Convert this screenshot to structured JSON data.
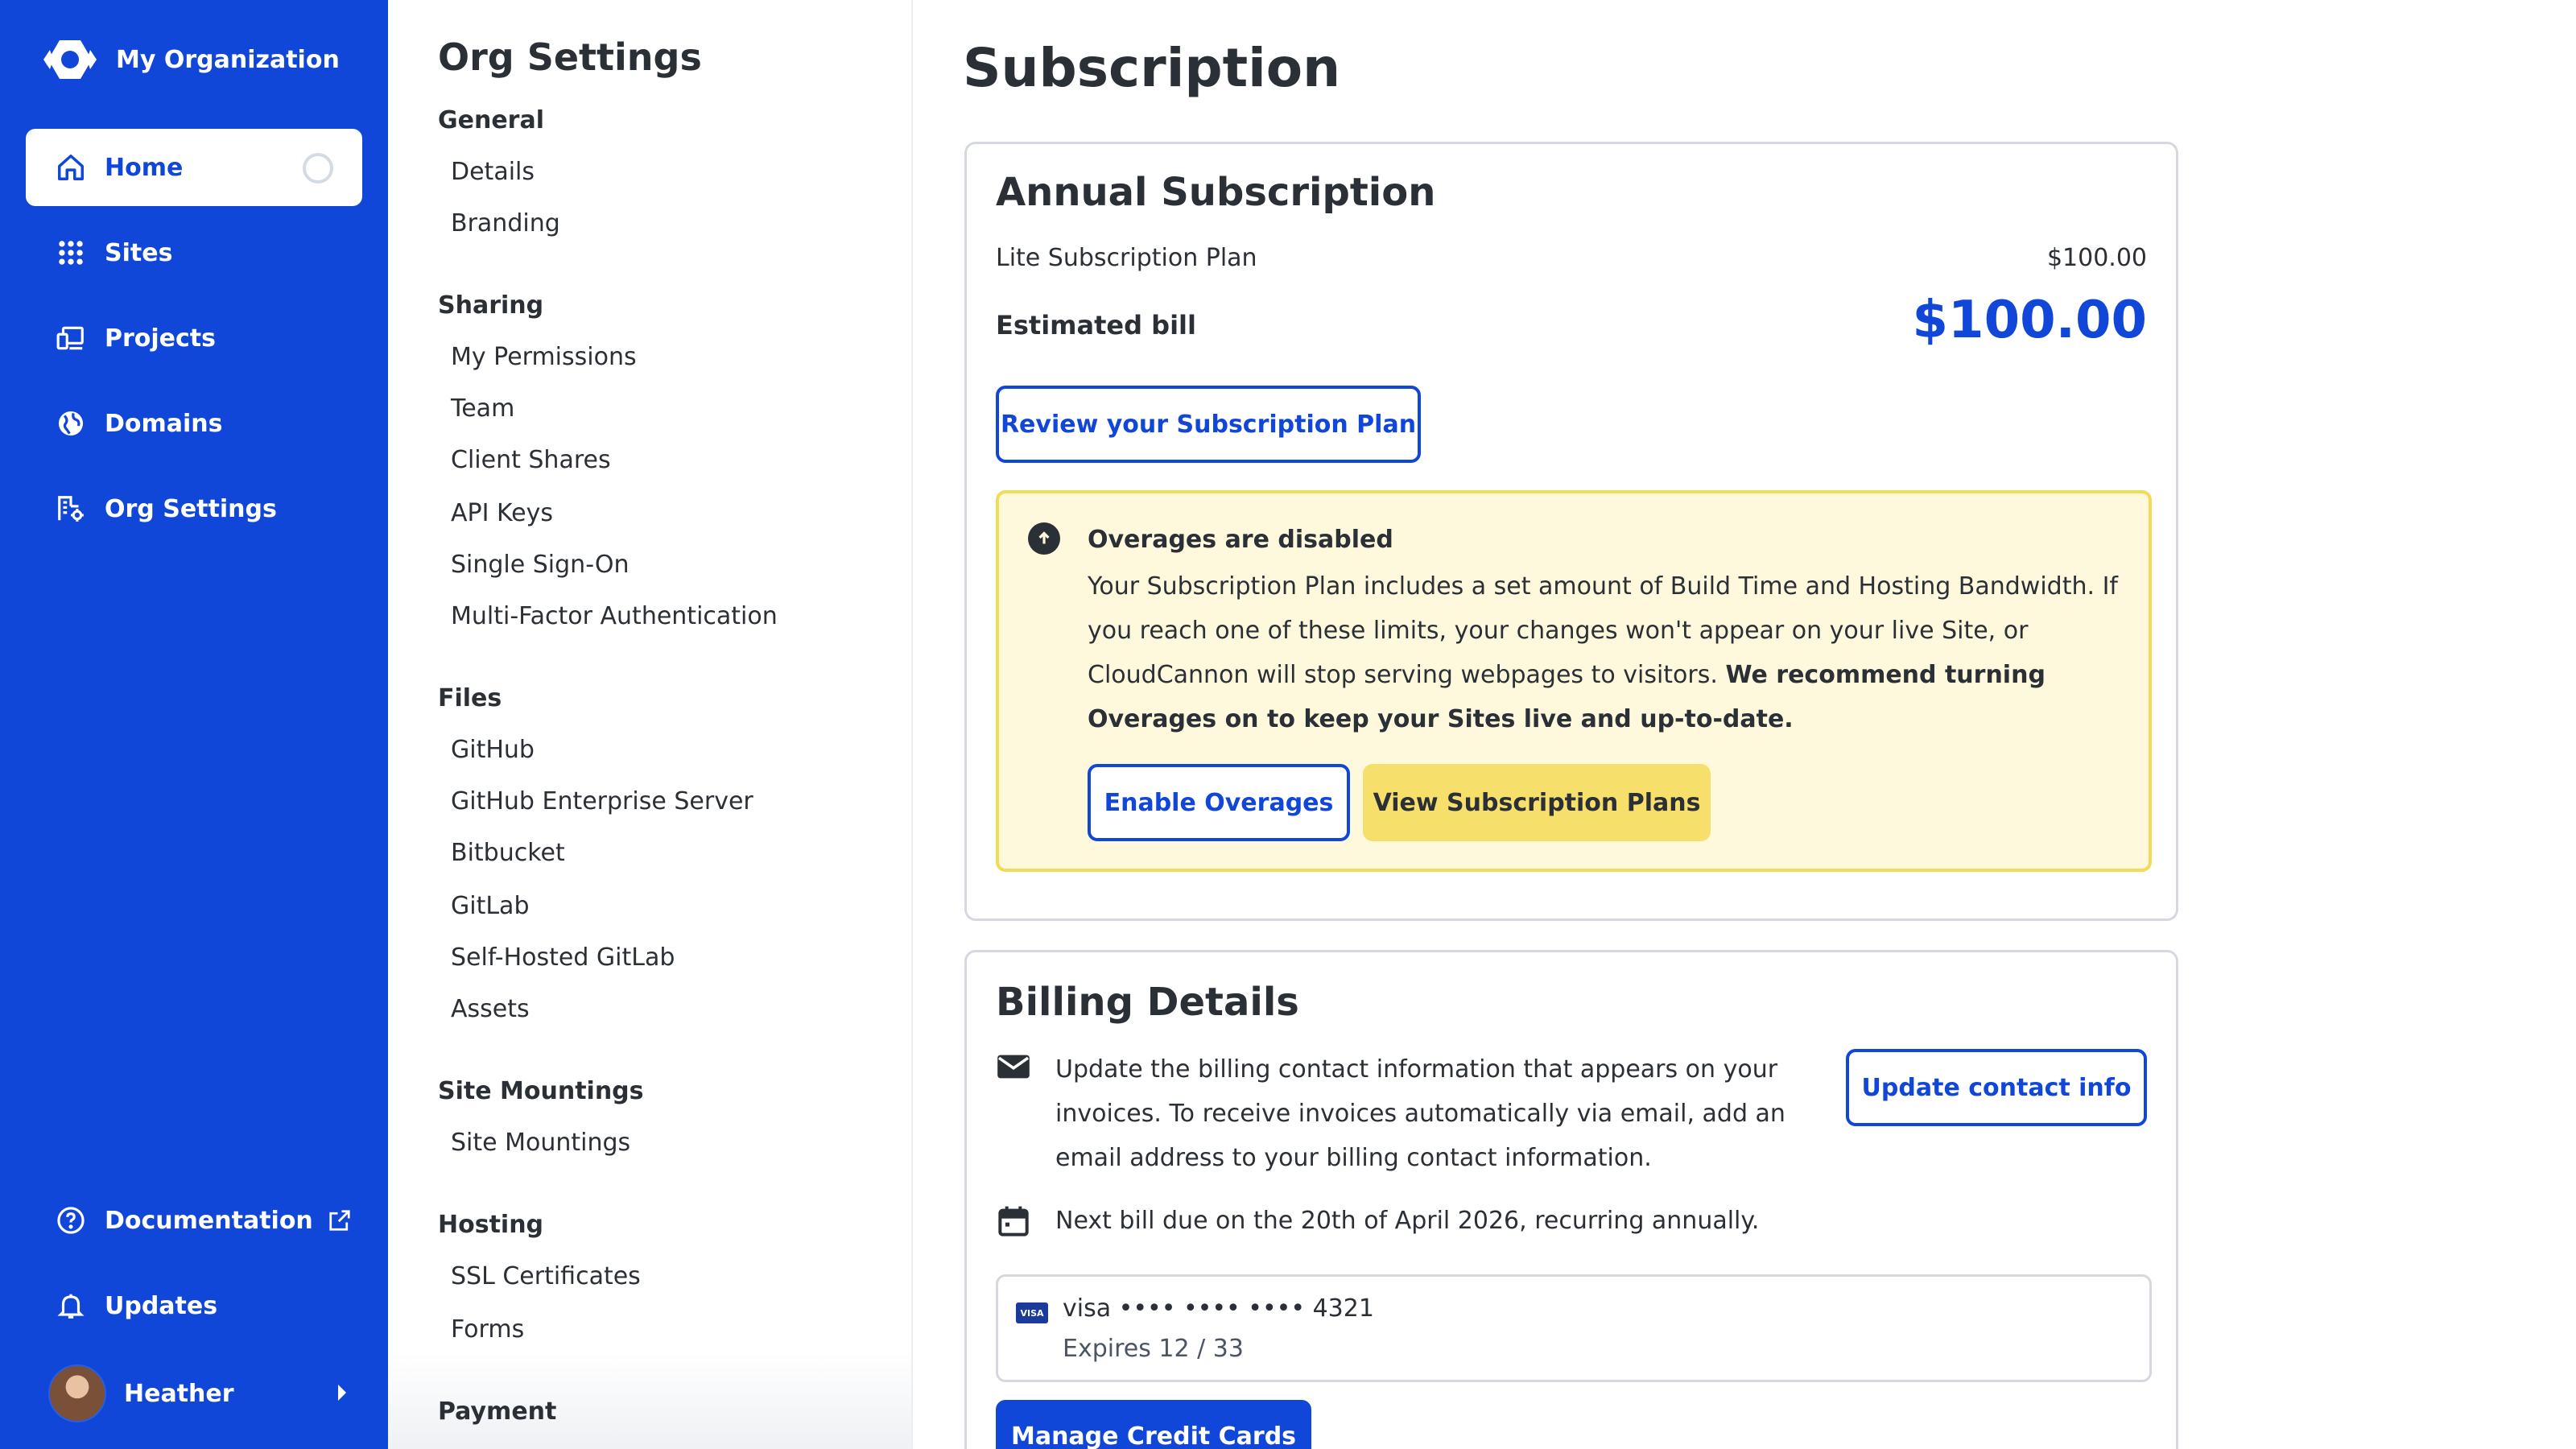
{
  "nav": {
    "org_name": "My Organization",
    "items": [
      {
        "label": "Home",
        "icon": "home-icon",
        "active": true
      },
      {
        "label": "Sites",
        "icon": "grid-icon"
      },
      {
        "label": "Projects",
        "icon": "devices-icon"
      },
      {
        "label": "Domains",
        "icon": "globe-icon"
      },
      {
        "label": "Org Settings",
        "icon": "building-settings-icon"
      }
    ],
    "footer": {
      "documentation": "Documentation",
      "updates": "Updates",
      "user": "Heather"
    },
    "colors": {
      "primary": "#1147d8",
      "accent_yellow": "#f7df6b"
    }
  },
  "settings": {
    "title": "Org Settings",
    "sections": [
      {
        "title": "General",
        "links": [
          "Details",
          "Branding"
        ]
      },
      {
        "title": "Sharing",
        "links": [
          "My Permissions",
          "Team",
          "Client Shares",
          "API Keys",
          "Single Sign-On",
          "Multi-Factor Authentication"
        ]
      },
      {
        "title": "Files",
        "links": [
          "GitHub",
          "GitHub Enterprise Server",
          "Bitbucket",
          "GitLab",
          "Self-Hosted GitLab",
          "Assets"
        ]
      },
      {
        "title": "Site Mountings",
        "links": [
          "Site Mountings"
        ]
      },
      {
        "title": "Hosting",
        "links": [
          "SSL Certificates",
          "Forms"
        ]
      },
      {
        "title": "Payment",
        "links": []
      }
    ]
  },
  "main": {
    "title": "Subscription",
    "annual": {
      "title": "Annual Subscription",
      "plan_label": "Lite Subscription Plan",
      "plan_price": "$100.00",
      "estimated_label": "Estimated bill",
      "estimated_value": "$100.00",
      "review_button": "Review your Subscription Plan",
      "alert": {
        "title": "Overages are disabled",
        "text": "Your Subscription Plan includes a set amount of Build Time and Hosting Bandwidth. If you reach one of these limits, your changes won't appear on your live Site, or CloudCannon will stop serving webpages to visitors.",
        "text_bold": "We recommend turning Overages on to keep your Sites live and up-to-date.",
        "enable_button": "Enable Overages",
        "view_button": "View Subscription Plans"
      }
    },
    "billing": {
      "title": "Billing Details",
      "contact_text": "Update the billing contact information that appears on your invoices. To receive invoices automatically via email, add an email address to your billing contact information.",
      "update_button": "Update contact info",
      "next_bill": "Next bill due on the 20th of April 2026, recurring annually.",
      "card_brand_badge": "VISA",
      "card_number": "visa •••• •••• •••• 4321",
      "card_expiry": "Expires 12 / 33",
      "manage_button": "Manage Credit Cards"
    }
  }
}
